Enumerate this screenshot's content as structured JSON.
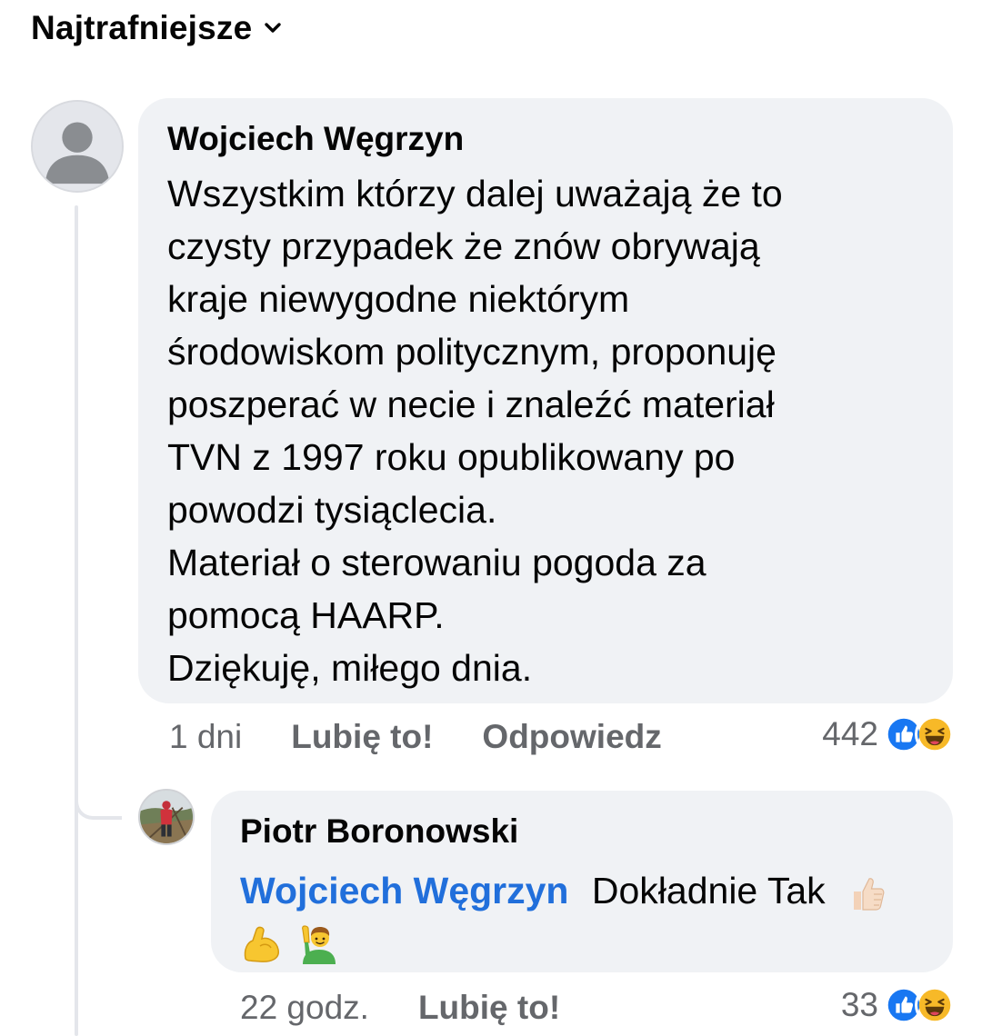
{
  "sort": {
    "label": "Najtrafniejsze"
  },
  "comments": [
    {
      "author": "Wojciech Węgrzyn",
      "lines": [
        "Wszystkim którzy dalej uważają że to",
        "czysty przypadek że znów obrywają",
        "kraje niewygodne niektórym",
        "środowiskom politycznym, proponuję",
        "poszperać w necie i znaleźć materiał",
        "TVN z 1997 roku opublikowany po",
        "powodzi tysiąclecia.",
        "Materiał o sterowaniu pogoda za",
        "pomocą HAARP.",
        "Dziękuję, miłego dnia."
      ],
      "timestamp": "1 dni",
      "like_label": "Lubię to!",
      "reply_label": "Odpowiedz",
      "reaction_count": "442",
      "reactions": [
        "like-icon",
        "haha-icon"
      ]
    }
  ],
  "replies": [
    {
      "author": "Piotr Boronowski",
      "mention": "Wojciech Węgrzyn",
      "text": "Dokładnie Tak",
      "emojis": [
        "thumbs-up-emoji",
        "flexed-biceps-emoji",
        "man-raising-hand-emoji"
      ],
      "timestamp": "22 godz.",
      "like_label": "Lubię to!",
      "reaction_count": "33",
      "reactions": [
        "like-icon",
        "haha-icon"
      ]
    }
  ],
  "colors": {
    "bubble": "#f0f2f5",
    "mention": "#216fdb",
    "meta": "#65676b",
    "like": "#1877f2",
    "haha": "#f7b928"
  }
}
